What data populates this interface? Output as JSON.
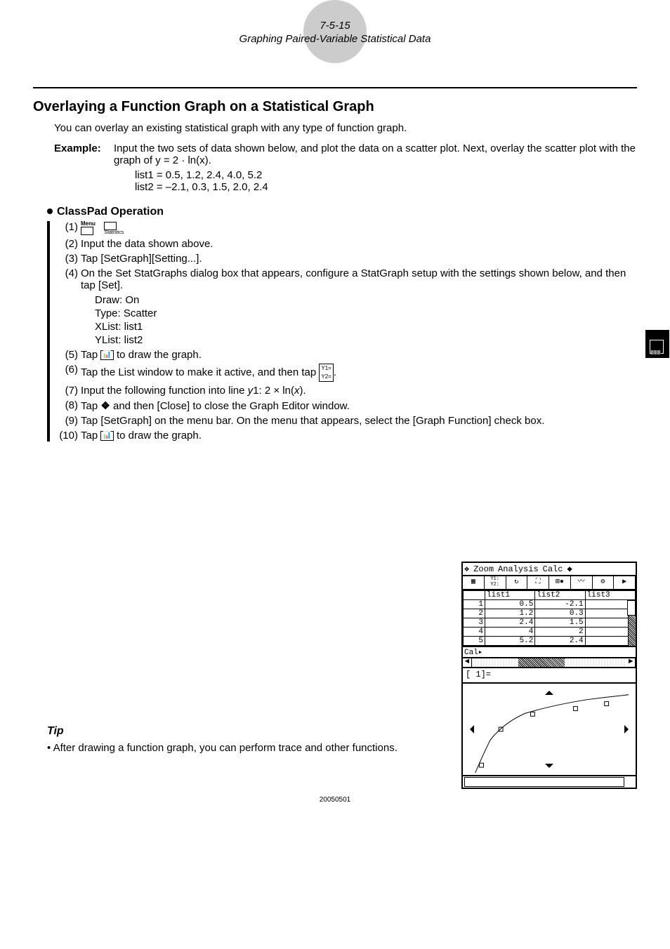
{
  "header": {
    "page_number": "7-5-15",
    "subtitle": "Graphing Paired-Variable Statistical Data"
  },
  "section_title": "Overlaying a Function Graph on a Statistical Graph",
  "intro": "You can overlay an existing statistical graph with any type of function graph.",
  "example": {
    "label": "Example:",
    "body_line1": "Input the two sets of data shown below, and plot the data on a scatter plot. Next, overlay the scatter plot with the graph of y = 2 · ln(x).",
    "list1": "list1 = 0.5,  1.2,  2.4,  4.0,  5.2",
    "list2": "list2 = –2.1,  0.3,  1.5,  2.0,  2.4"
  },
  "operation_heading": "ClassPad Operation",
  "steps": {
    "s1_label": "(1)",
    "s1_icon1": "Menu",
    "s1_icon2": "Statistics",
    "s2_label": "(2)",
    "s2_body": "Input the data shown above.",
    "s3_label": "(3)",
    "s3_body": "Tap [SetGraph][Setting...].",
    "s4_label": "(4)",
    "s4_body": "On the Set StatGraphs dialog box that appears, configure a StatGraph setup with the settings shown below, and then tap [Set].",
    "s4_settings": {
      "draw": "Draw: On",
      "type": "Type: Scatter",
      "xlist": "XList: list1",
      "ylist": "YList: list2"
    },
    "s5_label": "(5)",
    "s5_pre": "Tap ",
    "s5_post": " to draw the graph.",
    "s6_label": "(6)",
    "s6_pre": "Tap the List window to make it active, and then tap ",
    "s6_post": ".",
    "s7_label": "(7)",
    "s7_body": "Input the following function into line y1: 2 × ln(x).",
    "s8_label": "(8)",
    "s8_pre": "Tap ",
    "s8_post": " and then [Close] to close the Graph Editor window.",
    "s9_label": "(9)",
    "s9_body": "Tap [SetGraph] on the menu bar. On the menu that appears, select the [Graph Function] check box.",
    "s10_label": "(10)",
    "s10_pre": "Tap ",
    "s10_post": " to draw the graph."
  },
  "tip": {
    "heading": "Tip",
    "body": "• After drawing a function graph, you can perform trace and other functions."
  },
  "footer_code": "20050501",
  "calc": {
    "menu": {
      "zoom": "Zoom",
      "analysis": "Analysis",
      "calc": "Calc"
    },
    "list_headers": {
      "c1": "list1",
      "c2": "list2",
      "c3": "list3"
    },
    "rows": [
      {
        "n": "1",
        "a": "0.5",
        "b": "-2.1",
        "c": ""
      },
      {
        "n": "2",
        "a": "1.2",
        "b": "0.3",
        "c": ""
      },
      {
        "n": "3",
        "a": "2.4",
        "b": "1.5",
        "c": ""
      },
      {
        "n": "4",
        "a": "4",
        "b": "2",
        "c": ""
      },
      {
        "n": "5",
        "a": "5.2",
        "b": "2.4",
        "c": ""
      }
    ],
    "cal_row": "Cal▸",
    "input_line": "[    1]="
  },
  "chart_data": {
    "type": "scatter+line",
    "scatter": {
      "x": [
        0.5,
        1.2,
        2.4,
        4.0,
        5.2
      ],
      "y": [
        -2.1,
        0.3,
        1.5,
        2.0,
        2.4
      ]
    },
    "function": "y = 2*ln(x)",
    "xlim": [
      0,
      6
    ],
    "ylim": [
      -3,
      3
    ]
  }
}
